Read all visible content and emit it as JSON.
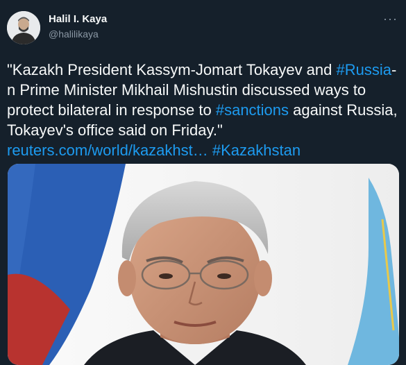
{
  "author": {
    "name": "Halil I. Kaya",
    "handle": "@halilikaya"
  },
  "more_label": "···",
  "tweet": {
    "seg1": "\"Kazakh President Kassym-Jomart Tokayev and ",
    "hashtag_russia": "#Russia",
    "seg2": "-n Prime Minister Mikhail Mishustin discussed ways to protect bilateral in response to ",
    "hashtag_sanctions": "#sanctions",
    "seg3": " against Russia, Tokayev's office said on Friday.\" ",
    "url": "reuters.com/world/kazakhst…",
    "seg4": " ",
    "hashtag_kazakhstan": "#Kazakhstan"
  },
  "colors": {
    "background": "#15202b",
    "link": "#1d9bf0",
    "secondary_text": "#8b98a5"
  }
}
